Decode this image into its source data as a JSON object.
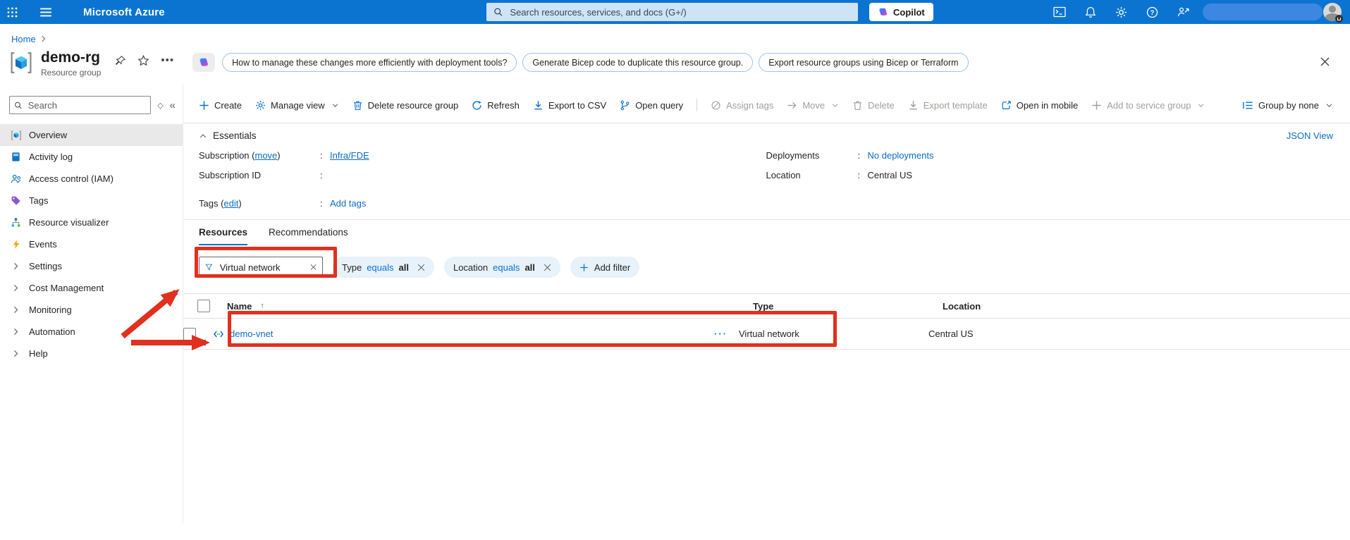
{
  "topbar": {
    "product": "Microsoft Azure",
    "search_placeholder": "Search resources, services, and docs (G+/)",
    "copilot": "Copilot"
  },
  "breadcrumb": {
    "home": "Home"
  },
  "page": {
    "title": "demo-rg",
    "subtitle": "Resource group",
    "suggestions": [
      "How to manage these changes more efficiently with deployment tools?",
      "Generate Bicep code to duplicate this resource group.",
      "Export resource groups using Bicep or Terraform"
    ]
  },
  "sidebar": {
    "search_placeholder": "Search",
    "items": [
      {
        "label": "Overview",
        "icon": "cube-icon",
        "selected": true
      },
      {
        "label": "Activity log",
        "icon": "activity-log-icon"
      },
      {
        "label": "Access control (IAM)",
        "icon": "people-icon"
      },
      {
        "label": "Tags",
        "icon": "tag-icon"
      },
      {
        "label": "Resource visualizer",
        "icon": "tree-icon"
      },
      {
        "label": "Events",
        "icon": "lightning-icon"
      },
      {
        "label": "Settings",
        "icon": "chevron-right-icon",
        "collapsible": true
      },
      {
        "label": "Cost Management",
        "icon": "chevron-right-icon",
        "collapsible": true
      },
      {
        "label": "Monitoring",
        "icon": "chevron-right-icon",
        "collapsible": true
      },
      {
        "label": "Automation",
        "icon": "chevron-right-icon",
        "collapsible": true
      },
      {
        "label": "Help",
        "icon": "chevron-right-icon",
        "collapsible": true
      }
    ]
  },
  "toolbar": {
    "create": "Create",
    "manage_view": "Manage view",
    "delete_resource_group": "Delete resource group",
    "refresh": "Refresh",
    "export_csv": "Export to CSV",
    "open_query": "Open query",
    "assign_tags": "Assign tags",
    "move": "Move",
    "delete": "Delete",
    "export_template": "Export template",
    "open_in_mobile": "Open in mobile",
    "add_to_service_group": "Add to service group",
    "group_by": "Group by none"
  },
  "essentials": {
    "title": "Essentials",
    "json_view": "JSON View",
    "subscription": {
      "prefix": "Subscription (",
      "link": "move",
      "suffix": ")",
      "colon": ":",
      "value": "Infra/FDE"
    },
    "subscription_id": {
      "label": "Subscription ID",
      "colon": ":",
      "value": ""
    },
    "tags": {
      "prefix": "Tags (",
      "link": "edit",
      "suffix": ")",
      "colon": ":",
      "value": "Add tags"
    },
    "deployments": {
      "label": "Deployments",
      "colon": ":",
      "value": "No deployments"
    },
    "location": {
      "label": "Location",
      "colon": ":",
      "value": "Central US"
    }
  },
  "tabs": {
    "resources": "Resources",
    "recommendations": "Recommendations"
  },
  "filters": {
    "search_value": "Virtual network",
    "type_pill": {
      "field": "Type",
      "op": "equals",
      "value": "all"
    },
    "location_pill": {
      "field": "Location",
      "op": "equals",
      "value": "all"
    },
    "add_filter": "Add filter"
  },
  "table": {
    "header": {
      "name": "Name",
      "sort_arrow": "↑",
      "type": "Type",
      "location": "Location"
    },
    "rows": [
      {
        "name": "demo-vnet",
        "type": "Virtual network",
        "location": "Central US",
        "ellipsis": "···"
      }
    ]
  },
  "colors": {
    "accent_blue": "#0b74d1",
    "link_blue": "#0b6cc4",
    "annotation_red": "#e0301e",
    "pill_bg": "#e7f2fb"
  }
}
